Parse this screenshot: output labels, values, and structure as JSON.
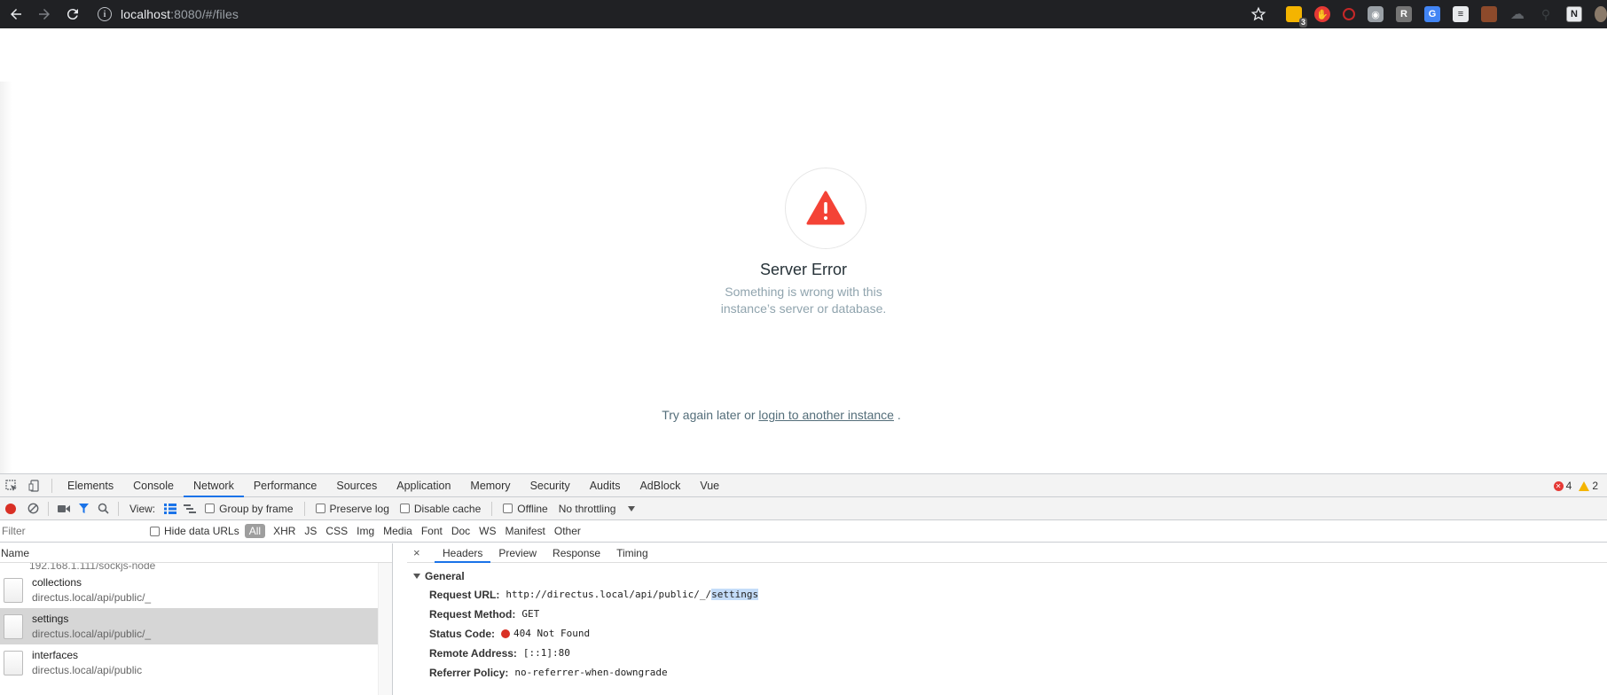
{
  "browser": {
    "url_host": "localhost",
    "url_rest": ":8080/#/files",
    "extensions": [
      {
        "name": "sticky-notes-icon",
        "color": "#f4b400",
        "badge": "3"
      },
      {
        "name": "red-hand-icon",
        "color": "#e53935",
        "badge": ""
      },
      {
        "name": "red-circle-icon",
        "color": "#c62828",
        "badge": ""
      },
      {
        "name": "camera-icon",
        "color": "#9aa0a6",
        "badge": ""
      },
      {
        "name": "r-extension-icon",
        "color": "#757575",
        "letter": "R",
        "badge": ""
      },
      {
        "name": "google-translate-icon",
        "color": "#4285f4",
        "badge": ""
      },
      {
        "name": "ninja-icon",
        "color": "#e8eaed",
        "badge": ""
      },
      {
        "name": "briefcase-icon",
        "color": "#8d4a2b",
        "badge": ""
      },
      {
        "name": "cloud-icon",
        "color": "#5f6368",
        "badge": ""
      },
      {
        "name": "dark-search-icon",
        "color": "#3c4043",
        "badge": ""
      },
      {
        "name": "notion-icon",
        "color": "#e8eaed",
        "letter": "N",
        "badge": ""
      }
    ]
  },
  "page": {
    "error_title": "Server Error",
    "error_desc_line1": "Something is wrong with this",
    "error_desc_line2": "instance’s server or database.",
    "retry_prefix": "Try again later or",
    "retry_link": "login to another instance",
    "retry_suffix": ".",
    "accent_red": "#f44336"
  },
  "devtools": {
    "tabs": [
      "Elements",
      "Console",
      "Network",
      "Performance",
      "Sources",
      "Application",
      "Memory",
      "Security",
      "Audits",
      "AdBlock",
      "Vue"
    ],
    "active_tab": "Network",
    "error_count": "4",
    "warning_count": "2",
    "toolbar": {
      "view_label": "View:",
      "group_by_frame": "Group by frame",
      "preserve_log": "Preserve log",
      "disable_cache": "Disable cache",
      "offline": "Offline",
      "throttling": "No throttling"
    },
    "filterbar": {
      "filter_placeholder": "Filter",
      "hide_data_urls": "Hide data URLs",
      "types": [
        "All",
        "XHR",
        "JS",
        "CSS",
        "Img",
        "Media",
        "Font",
        "Doc",
        "WS",
        "Manifest",
        "Other"
      ]
    },
    "requests": {
      "column_name": "Name",
      "partial_row": "192.168.1.111/sockjs-node",
      "rows": [
        {
          "name": "collections",
          "url": "directus.local/api/public/_",
          "selected": false
        },
        {
          "name": "settings",
          "url": "directus.local/api/public/_",
          "selected": true
        },
        {
          "name": "interfaces",
          "url": "directus.local/api/public",
          "selected": false
        }
      ]
    },
    "details": {
      "close": "×",
      "tabs": [
        "Headers",
        "Preview",
        "Response",
        "Timing"
      ],
      "active_tab": "Headers",
      "section": "General",
      "request_url_label": "Request URL:",
      "request_url_value": "http://directus.local/api/public/_/",
      "request_url_highlight": "settings",
      "request_method_label": "Request Method:",
      "request_method_value": "GET",
      "status_code_label": "Status Code:",
      "status_code_value": "404 Not Found",
      "remote_address_label": "Remote Address:",
      "remote_address_value": "[::1]:80",
      "referrer_policy_label": "Referrer Policy:",
      "referrer_policy_value": "no-referrer-when-downgrade"
    }
  }
}
